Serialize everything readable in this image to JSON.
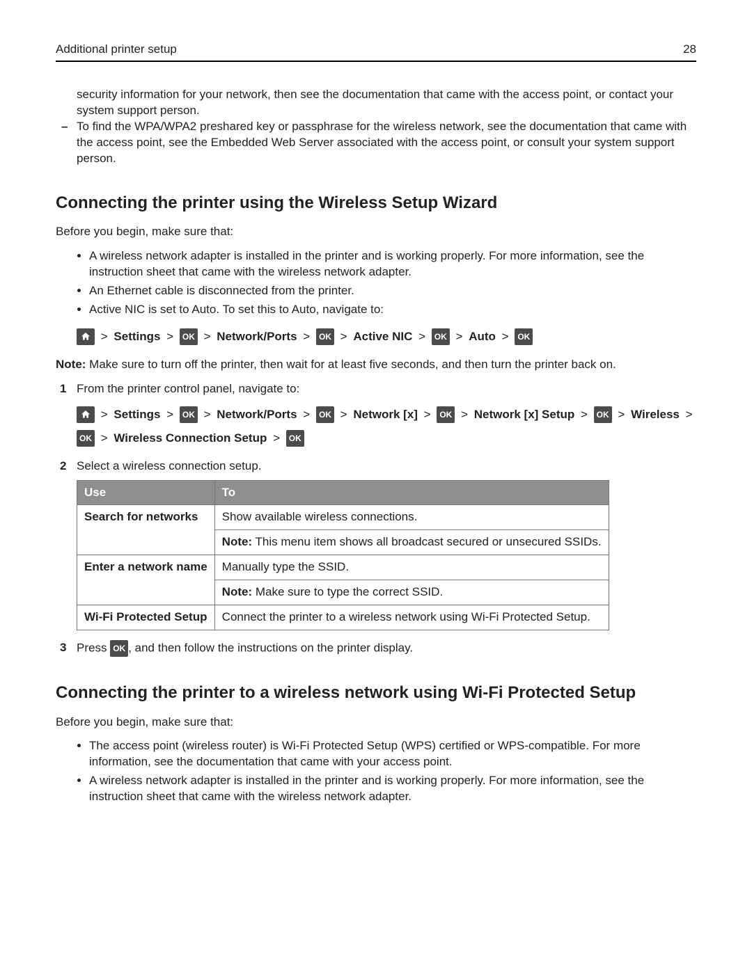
{
  "header": {
    "section": "Additional printer setup",
    "page": "28"
  },
  "intro": {
    "p1": "security information for your network, then see the documentation that came with the access point, or contact your system support person.",
    "dash1": "To find the WPA/WPA2 preshared key or passphrase for the wireless network, see the documentation that came with the access point, see the Embedded Web Server associated with the access point, or consult your system support person."
  },
  "sec1": {
    "title": "Connecting the printer using the Wireless Setup Wizard",
    "before": "Before you begin, make sure that:",
    "bul1": "A wireless network adapter is installed in the printer and is working properly. For more information, see the instruction sheet that came with the wireless network adapter.",
    "bul2": "An Ethernet cable is disconnected from the printer.",
    "bul3": "Active NIC is set to Auto. To set this to Auto, navigate to:",
    "path1": {
      "settings": "Settings",
      "np": "Network/Ports",
      "active": "Active NIC",
      "auto": "Auto"
    },
    "noteLabel": "Note:",
    "note": " Make sure to turn off the printer, then wait for at least five seconds, and then turn the printer back on.",
    "step1": "From the printer control panel, navigate to:",
    "path2": {
      "settings": "Settings",
      "np": "Network/Ports",
      "nx": "Network [x]",
      "nxs": "Network [x] Setup",
      "wl": "Wireless",
      "wcs": "Wireless Connection Setup"
    },
    "step2": "Select a wireless connection setup.",
    "table": {
      "h1": "Use",
      "h2": "To",
      "r1c1": "Search for networks",
      "r1c2a": "Show available wireless connections.",
      "r1c2bLabel": "Note:",
      "r1c2b": " This menu item shows all broadcast secured or unsecured SSIDs.",
      "r2c1": "Enter a network name",
      "r2c2a": "Manually type the SSID.",
      "r2c2bLabel": "Note:",
      "r2c2b": " Make sure to type the correct SSID.",
      "r3c1": "Wi-Fi Protected Setup",
      "r3c2": "Connect the printer to a wireless network using Wi-Fi Protected Setup."
    },
    "step3a": "Press ",
    "step3b": ", and then follow the instructions on the printer display."
  },
  "sec2": {
    "title": "Connecting the printer to a wireless network using Wi-Fi Protected Setup",
    "before": "Before you begin, make sure that:",
    "bul1": "The access point (wireless router) is Wi-Fi Protected Setup (WPS) certified or WPS-compatible. For more information, see the documentation that came with your access point.",
    "bul2": "A wireless network adapter is installed in the printer and is working properly. For more information, see the instruction sheet that came with the wireless network adapter."
  },
  "icons": {
    "ok": "OK"
  }
}
